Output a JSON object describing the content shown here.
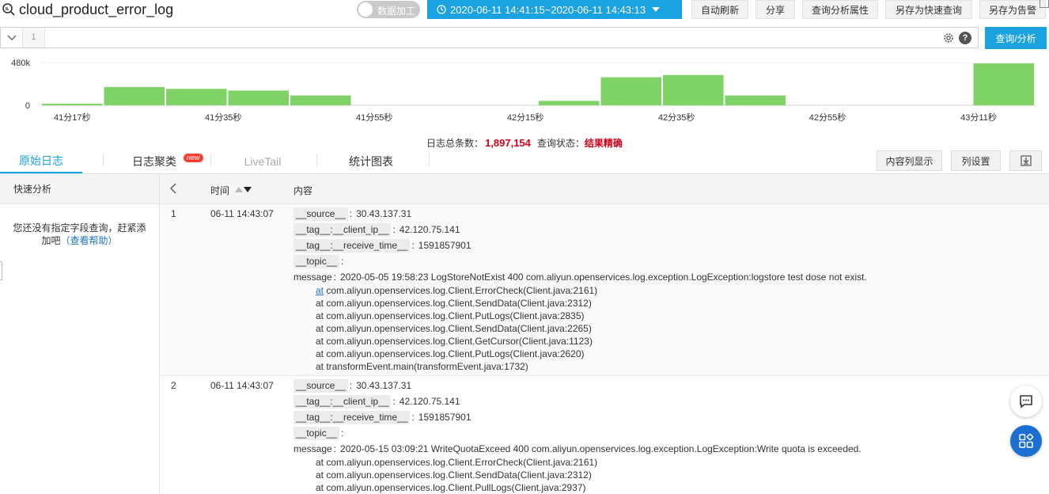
{
  "header": {
    "logstore_name": "cloud_product_error_log",
    "data_processing_label": "数据加工",
    "time_range": "2020-06-11 14:41:15~2020-06-11 14:43:13",
    "buttons": {
      "auto_refresh": "自动刷新",
      "share": "分享",
      "query_attrs": "查询分析属性",
      "save_quick_query": "另存为快速查询",
      "save_alert": "另存为告警"
    }
  },
  "query": {
    "line_number": "1",
    "value": "",
    "submit_label": "查询/分析",
    "help_glyph": "?"
  },
  "histogram": {
    "y_ticks": [
      "480k",
      "0"
    ],
    "x_ticks": [
      "41分17秒",
      "41分35秒",
      "41分55秒",
      "42分15秒",
      "42分35秒",
      "42分55秒",
      "43分11秒"
    ],
    "bar_color": "#7ed266",
    "max_value": 480000,
    "bars": [
      15000,
      205000,
      185000,
      165000,
      110000,
      0,
      0,
      0,
      50000,
      315000,
      340000,
      110000,
      0,
      0,
      0,
      470000
    ]
  },
  "summary": {
    "total_label": "日志总条数：",
    "total_value": "1,897,154",
    "status_label": "查询状态：",
    "status_value": "结果精确"
  },
  "tabs": {
    "raw": "原始日志",
    "cluster": "日志聚类",
    "cluster_badge": "new",
    "livetail": "LiveTail",
    "chart": "统计图表",
    "content_columns": "内容列显示",
    "column_settings": "列设置"
  },
  "sidebar": {
    "title": "快速分析",
    "note": "您还没有指定字段查询，赶紧添加吧",
    "help_link": "（查看帮助）"
  },
  "table": {
    "col_time": "时间",
    "col_content": "内容",
    "rows": [
      {
        "index": "1",
        "time": "06-11 14:43:07",
        "fields": [
          {
            "key": "__source__",
            "value": "30.43.137.31"
          },
          {
            "key": "__tag__:__client_ip__",
            "value": "42.120.75.141"
          },
          {
            "key": "__tag__:__receive_time__",
            "value": "1591857901"
          },
          {
            "key": "__topic__",
            "value": ""
          }
        ],
        "message_key": "message",
        "message": "2020-05-05 19:58:23 LogStoreNotExist 400 com.aliyun.openservices.log.exception.LogException:logstore test dose not exist.",
        "stack_first_link": "at",
        "stack_first_rest": " com.aliyun.openservices.log.Client.ErrorCheck(Client.java:2161)",
        "stack": [
          "at com.aliyun.openservices.log.Client.SendData(Client.java:2312)",
          "at com.aliyun.openservices.log.Client.PutLogs(Client.java:2835)",
          "at com.aliyun.openservices.log.Client.SendData(Client.java:2265)",
          "at com.aliyun.openservices.log.Client.GetCursor(Client.java:1123)",
          "at com.aliyun.openservices.log.Client.PutLogs(Client.java:2620)",
          "at transformEvent.main(transformEvent.java:1732)"
        ]
      },
      {
        "index": "2",
        "time": "06-11 14:43:07",
        "fields": [
          {
            "key": "__source__",
            "value": "30.43.137.31"
          },
          {
            "key": "__tag__:__client_ip__",
            "value": "42.120.75.141"
          },
          {
            "key": "__tag__:__receive_time__",
            "value": "1591857901"
          },
          {
            "key": "__topic__",
            "value": ""
          }
        ],
        "message_key": "message",
        "message": "2020-05-15 03:09:21 WriteQuotaExceed 400 com.aliyun.openservices.log.exception.LogException:Write quota is exceeded.",
        "stack": [
          "at com.aliyun.openservices.log.Client.ErrorCheck(Client.java:2161)",
          "at com.aliyun.openservices.log.Client.SendData(Client.java:2312)",
          "at com.aliyun.openservices.log.Client.PullLogs(Client.java:2937)"
        ]
      }
    ]
  },
  "icons": {
    "search": "search-icon",
    "clock": "clock-icon",
    "gear": "gear-icon",
    "help": "help-icon",
    "download": "download-icon",
    "chat": "chat-icon",
    "apps": "apps-icon"
  },
  "colors": {
    "primary": "#1aa3e0",
    "alert_red": "#d0021b",
    "bar_green": "#7ed266"
  }
}
